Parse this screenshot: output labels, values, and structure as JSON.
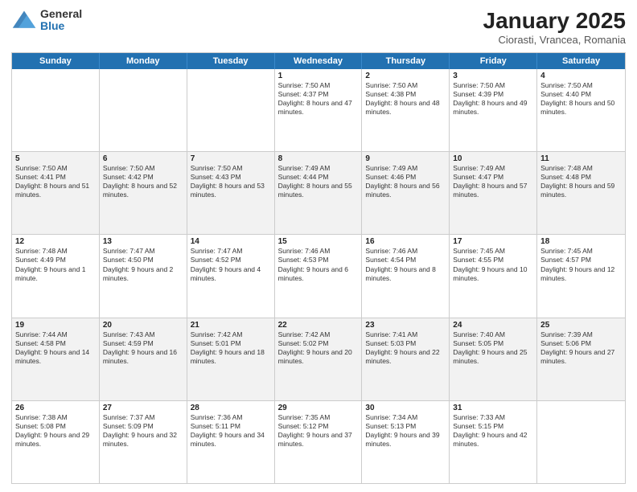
{
  "logo": {
    "general": "General",
    "blue": "Blue"
  },
  "title": "January 2025",
  "subtitle": "Ciorasti, Vrancea, Romania",
  "header_days": [
    "Sunday",
    "Monday",
    "Tuesday",
    "Wednesday",
    "Thursday",
    "Friday",
    "Saturday"
  ],
  "weeks": [
    {
      "alt": false,
      "cells": [
        {
          "day": "",
          "text": ""
        },
        {
          "day": "",
          "text": ""
        },
        {
          "day": "",
          "text": ""
        },
        {
          "day": "1",
          "text": "Sunrise: 7:50 AM\nSunset: 4:37 PM\nDaylight: 8 hours and 47 minutes."
        },
        {
          "day": "2",
          "text": "Sunrise: 7:50 AM\nSunset: 4:38 PM\nDaylight: 8 hours and 48 minutes."
        },
        {
          "day": "3",
          "text": "Sunrise: 7:50 AM\nSunset: 4:39 PM\nDaylight: 8 hours and 49 minutes."
        },
        {
          "day": "4",
          "text": "Sunrise: 7:50 AM\nSunset: 4:40 PM\nDaylight: 8 hours and 50 minutes."
        }
      ]
    },
    {
      "alt": true,
      "cells": [
        {
          "day": "5",
          "text": "Sunrise: 7:50 AM\nSunset: 4:41 PM\nDaylight: 8 hours and 51 minutes."
        },
        {
          "day": "6",
          "text": "Sunrise: 7:50 AM\nSunset: 4:42 PM\nDaylight: 8 hours and 52 minutes."
        },
        {
          "day": "7",
          "text": "Sunrise: 7:50 AM\nSunset: 4:43 PM\nDaylight: 8 hours and 53 minutes."
        },
        {
          "day": "8",
          "text": "Sunrise: 7:49 AM\nSunset: 4:44 PM\nDaylight: 8 hours and 55 minutes."
        },
        {
          "day": "9",
          "text": "Sunrise: 7:49 AM\nSunset: 4:46 PM\nDaylight: 8 hours and 56 minutes."
        },
        {
          "day": "10",
          "text": "Sunrise: 7:49 AM\nSunset: 4:47 PM\nDaylight: 8 hours and 57 minutes."
        },
        {
          "day": "11",
          "text": "Sunrise: 7:48 AM\nSunset: 4:48 PM\nDaylight: 8 hours and 59 minutes."
        }
      ]
    },
    {
      "alt": false,
      "cells": [
        {
          "day": "12",
          "text": "Sunrise: 7:48 AM\nSunset: 4:49 PM\nDaylight: 9 hours and 1 minute."
        },
        {
          "day": "13",
          "text": "Sunrise: 7:47 AM\nSunset: 4:50 PM\nDaylight: 9 hours and 2 minutes."
        },
        {
          "day": "14",
          "text": "Sunrise: 7:47 AM\nSunset: 4:52 PM\nDaylight: 9 hours and 4 minutes."
        },
        {
          "day": "15",
          "text": "Sunrise: 7:46 AM\nSunset: 4:53 PM\nDaylight: 9 hours and 6 minutes."
        },
        {
          "day": "16",
          "text": "Sunrise: 7:46 AM\nSunset: 4:54 PM\nDaylight: 9 hours and 8 minutes."
        },
        {
          "day": "17",
          "text": "Sunrise: 7:45 AM\nSunset: 4:55 PM\nDaylight: 9 hours and 10 minutes."
        },
        {
          "day": "18",
          "text": "Sunrise: 7:45 AM\nSunset: 4:57 PM\nDaylight: 9 hours and 12 minutes."
        }
      ]
    },
    {
      "alt": true,
      "cells": [
        {
          "day": "19",
          "text": "Sunrise: 7:44 AM\nSunset: 4:58 PM\nDaylight: 9 hours and 14 minutes."
        },
        {
          "day": "20",
          "text": "Sunrise: 7:43 AM\nSunset: 4:59 PM\nDaylight: 9 hours and 16 minutes."
        },
        {
          "day": "21",
          "text": "Sunrise: 7:42 AM\nSunset: 5:01 PM\nDaylight: 9 hours and 18 minutes."
        },
        {
          "day": "22",
          "text": "Sunrise: 7:42 AM\nSunset: 5:02 PM\nDaylight: 9 hours and 20 minutes."
        },
        {
          "day": "23",
          "text": "Sunrise: 7:41 AM\nSunset: 5:03 PM\nDaylight: 9 hours and 22 minutes."
        },
        {
          "day": "24",
          "text": "Sunrise: 7:40 AM\nSunset: 5:05 PM\nDaylight: 9 hours and 25 minutes."
        },
        {
          "day": "25",
          "text": "Sunrise: 7:39 AM\nSunset: 5:06 PM\nDaylight: 9 hours and 27 minutes."
        }
      ]
    },
    {
      "alt": false,
      "cells": [
        {
          "day": "26",
          "text": "Sunrise: 7:38 AM\nSunset: 5:08 PM\nDaylight: 9 hours and 29 minutes."
        },
        {
          "day": "27",
          "text": "Sunrise: 7:37 AM\nSunset: 5:09 PM\nDaylight: 9 hours and 32 minutes."
        },
        {
          "day": "28",
          "text": "Sunrise: 7:36 AM\nSunset: 5:11 PM\nDaylight: 9 hours and 34 minutes."
        },
        {
          "day": "29",
          "text": "Sunrise: 7:35 AM\nSunset: 5:12 PM\nDaylight: 9 hours and 37 minutes."
        },
        {
          "day": "30",
          "text": "Sunrise: 7:34 AM\nSunset: 5:13 PM\nDaylight: 9 hours and 39 minutes."
        },
        {
          "day": "31",
          "text": "Sunrise: 7:33 AM\nSunset: 5:15 PM\nDaylight: 9 hours and 42 minutes."
        },
        {
          "day": "",
          "text": ""
        }
      ]
    }
  ]
}
